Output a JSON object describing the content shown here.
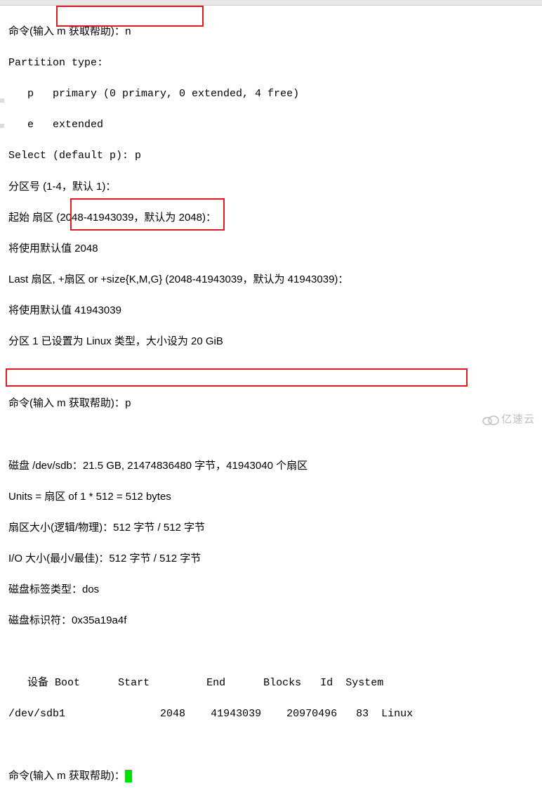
{
  "cmd1": {
    "prefix": "命令(输入 m 获取帮助)：",
    "input": "n"
  },
  "ptype": {
    "header": "Partition type:",
    "p_line": "   p   primary (0 primary, 0 extended, 4 free)",
    "e_line": "   e   extended"
  },
  "select_line": {
    "label": "Select (default p): ",
    "value": "p"
  },
  "pnum_line": "分区号 (1-4，默认 1)：",
  "start_sector": "起始 扇区 (2048-41943039，默认为 2048)：",
  "use_default1": "将使用默认值 2048",
  "last_sector": "Last 扇区, +扇区 or +size{K,M,G} (2048-41943039，默认为 41943039)：",
  "use_default2": "将使用默认值 41943039",
  "set_line": "分区 1 已设置为 Linux 类型，大小设为 20 GiB",
  "cmd2": {
    "prefix": "命令(输入 m 获取帮助)：",
    "input": "p"
  },
  "disk": "磁盘 /dev/sdb：21.5 GB, 21474836480 字节，41943040 个扇区",
  "units": "Units = 扇区 of 1 * 512 = 512 bytes",
  "sector_size": "扇区大小(逻辑/物理)：512 字节 / 512 字节",
  "io_size": "I/O 大小(最小/最佳)：512 字节 / 512 字节",
  "label_type": "磁盘标签类型：dos",
  "disk_id": "磁盘标识符：0x35a19a4f",
  "table": {
    "headers": {
      "dev": "设备",
      "boot": "Boot",
      "start": "Start",
      "end": "End",
      "blocks": "Blocks",
      "id": "Id",
      "system": "System"
    },
    "row": {
      "dev": "/dev/sdb1",
      "boot": "",
      "start": "2048",
      "end": "41943039",
      "blocks": "20970496",
      "id": "83",
      "system": "Linux"
    }
  },
  "cmd3": {
    "prefix": "命令(输入 m 获取帮助)："
  },
  "logo": "亿速云"
}
